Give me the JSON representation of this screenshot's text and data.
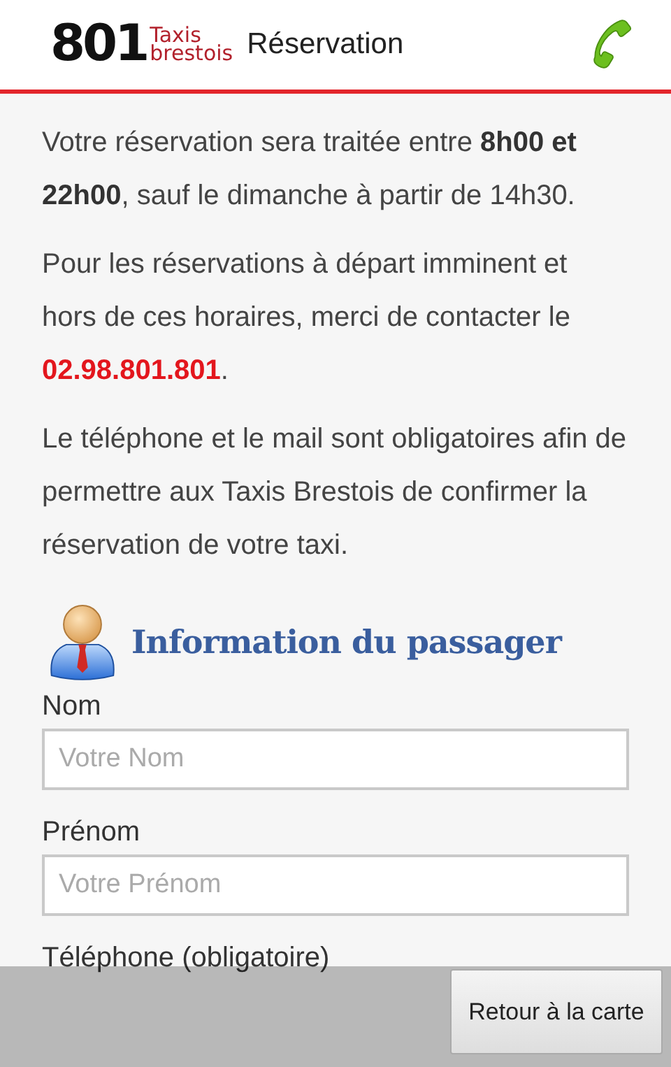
{
  "header": {
    "logo": {
      "number": "801",
      "line_1": "Taxis",
      "line_2": "brestois"
    },
    "title": "Réservation"
  },
  "paragraphs": [
    [
      {
        "kind": "text",
        "text": "Votre réservation sera traitée entre **8h00 et 22h00**, sauf le dimanche à partir de 14h30."
      }
    ],
    [
      {
        "kind": "text",
        "text": "Pour les réservations à départ imminent et hors de ces horaires, merci de contacter le "
      },
      {
        "kind": "phone",
        "text": "02.98.801.801"
      },
      {
        "kind": "text",
        "text": "."
      }
    ],
    [
      {
        "kind": "text",
        "text": "Le téléphone et le mail sont obligatoires afin de permettre aux Taxis Brestois de confirmer la réservation de votre taxi."
      }
    ]
  ],
  "section_title": "Information du passager",
  "fields": [
    {
      "label": "Nom",
      "placeholder": "Votre Nom"
    },
    {
      "label": "Prénom",
      "placeholder": "Votre Prénom"
    },
    {
      "label": "Téléphone (obligatoire)"
    }
  ],
  "bottom_bar": {
    "button": "Retour à la carte"
  }
}
